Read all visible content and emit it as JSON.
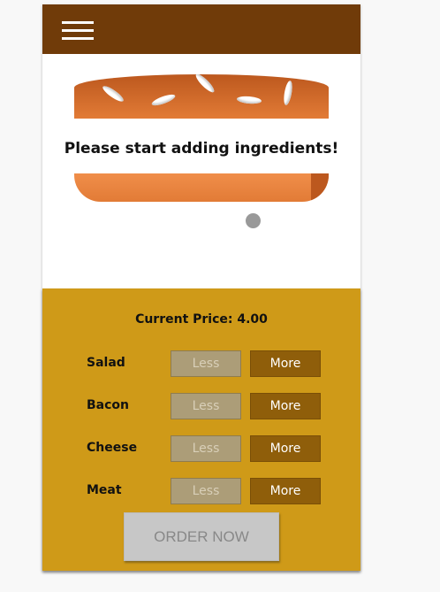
{
  "toolbar": {
    "menu_icon": "hamburger-menu-icon"
  },
  "burger": {
    "message": "Please start adding ingredients!",
    "colors": {
      "bread_top": "#bc581e",
      "bread_bottom": "#e27b36"
    }
  },
  "controls": {
    "price_label": "Current Price: 4.00",
    "ingredients": [
      {
        "label": "Salad",
        "less_label": "Less",
        "more_label": "More"
      },
      {
        "label": "Bacon",
        "less_label": "Less",
        "more_label": "More"
      },
      {
        "label": "Cheese",
        "less_label": "Less",
        "more_label": "More"
      },
      {
        "label": "Meat",
        "less_label": "Less",
        "more_label": "More"
      }
    ],
    "order_label": "ORDER NOW"
  },
  "colors": {
    "toolbar": "#703b09",
    "controls_bg": "#cf9a18",
    "more_button": "#8f5e0a",
    "less_button_disabled": "#ac9d78",
    "order_button_disabled": "#c7c7c7"
  }
}
